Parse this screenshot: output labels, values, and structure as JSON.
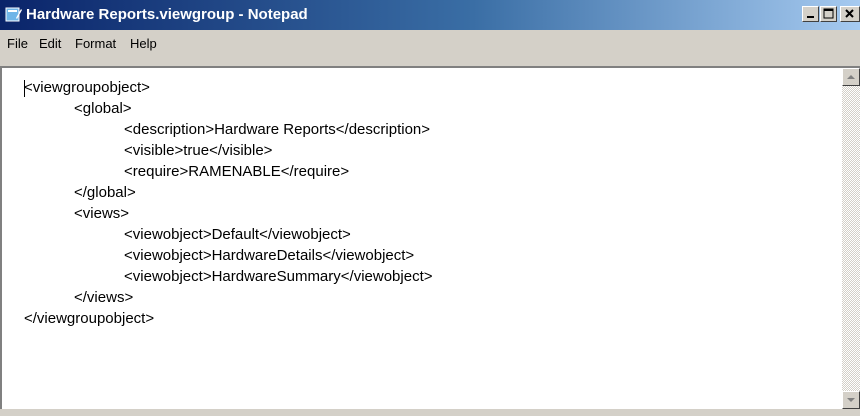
{
  "window": {
    "title": "Hardware Reports.viewgroup - Notepad",
    "controls": {
      "minimize_icon": "minimize-icon",
      "maximize_icon": "maximize-icon",
      "close_icon": "close-icon"
    },
    "title_gradient": [
      "#0a246a",
      "#3a6ea5",
      "#a6caf0"
    ]
  },
  "menu": {
    "file": "File",
    "edit": "Edit",
    "format": "Format",
    "help": "Help"
  },
  "editor": {
    "lines": [
      "<viewgroupobject>",
      "            <global>",
      "                        <description>Hardware Reports</description>",
      "                        <visible>true</visible>",
      "                        <require>RAMENABLE</require>",
      "            </global>",
      "            <views>",
      "                        <viewobject>Default</viewobject>",
      "                        <viewobject>HardwareDetails</viewobject>",
      "                        <viewobject>HardwareSummary</viewobject>",
      "            </views>",
      "</viewgroupobject>"
    ]
  }
}
